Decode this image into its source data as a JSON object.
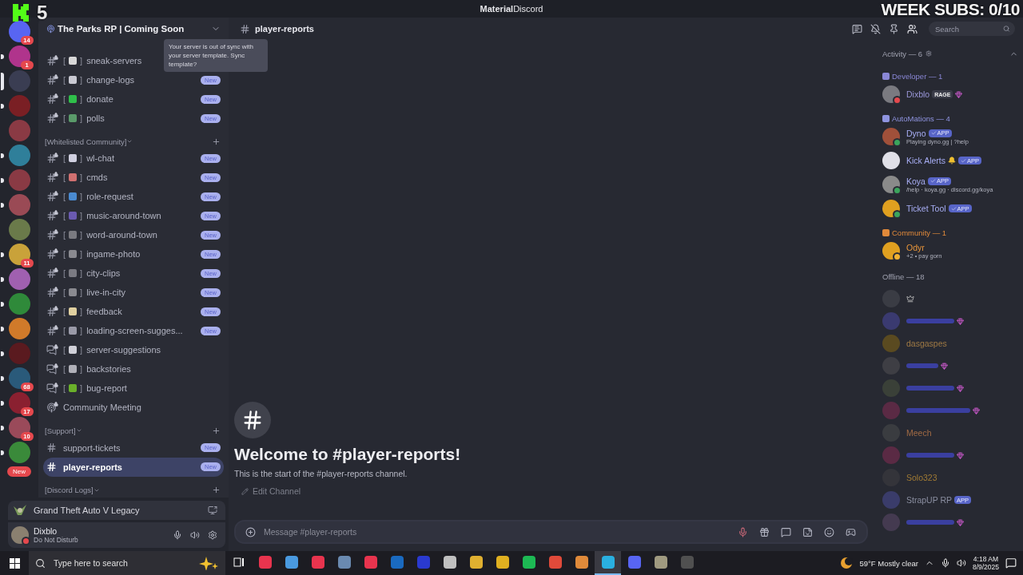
{
  "title_bar": {
    "title": "**Material**Discord",
    "overlay_count": "5",
    "subs": "WEEK SUBS: 0/10"
  },
  "servers": [
    {
      "mentions": "14",
      "unread": false,
      "selected": false,
      "color": "#5865f2"
    },
    {
      "mentions": "1",
      "unread": true,
      "selected": false,
      "color": "#b0348c"
    },
    {
      "unread": false,
      "selected": true,
      "color": "#3a3d52"
    },
    {
      "unread": true,
      "selected": false,
      "color": "#7a1f24"
    },
    {
      "unread": false,
      "selected": false,
      "color": "#8a3a44"
    },
    {
      "unread": true,
      "selected": false,
      "color": "#2f7f9a"
    },
    {
      "unread": true,
      "selected": false,
      "color": "#8a3a44"
    },
    {
      "unread": true,
      "selected": false,
      "color": "#9a4a55"
    },
    {
      "unread": false,
      "selected": false,
      "color": "#6a7a4a"
    },
    {
      "mentions": "11",
      "unread": true,
      "selected": false,
      "color": "#c9a23a"
    },
    {
      "unread": true,
      "selected": false,
      "color": "#a060b0"
    },
    {
      "unread": true,
      "selected": false,
      "color": "#2f8a3a"
    },
    {
      "unread": true,
      "selected": false,
      "color": "#d07a2a"
    },
    {
      "unread": true,
      "selected": false,
      "color": "#5a1a1f"
    },
    {
      "mentions": "68",
      "unread": true,
      "selected": false,
      "color": "#2a5a7a"
    },
    {
      "mentions": "17",
      "unread": true,
      "selected": false,
      "color": "#8a2030"
    },
    {
      "mentions": "10",
      "unread": true,
      "selected": false,
      "color": "#9a4a5a"
    },
    {
      "unread": true,
      "selected": false,
      "color": "#3a8a3a"
    }
  ],
  "new_pill": "New",
  "channel_pane": {
    "server_name": "The Parks RP | Coming Soon",
    "tooltip": "Your server is out of sync with your server template. Sync template?",
    "brackets": [
      "[",
      "]"
    ],
    "sections": [
      {
        "channels": [
          {
            "kind": "text",
            "name": "sneak-servers",
            "locked": true,
            "color": "#d8d8d8",
            "selected": false
          },
          {
            "kind": "text",
            "name": "change-logs",
            "locked": true,
            "color": "#c9c9d2",
            "badge": "New",
            "selected": false
          },
          {
            "kind": "text",
            "name": "donate",
            "locked": true,
            "color": "#2fbf4a",
            "badge": "New",
            "selected": false
          },
          {
            "kind": "text",
            "name": "polls",
            "locked": true,
            "color": "#5a9a6a",
            "badge": "New",
            "selected": false
          }
        ]
      },
      {
        "category": "[Whitelisted Community]",
        "channels": [
          {
            "kind": "text",
            "name": "wl-chat",
            "locked": true,
            "color": "#d0d0e0",
            "badge": "New",
            "selected": false
          },
          {
            "kind": "text",
            "name": "cmds",
            "locked": true,
            "color": "#d07070",
            "badge": "New",
            "selected": false
          },
          {
            "kind": "text",
            "name": "role-request",
            "locked": true,
            "color": "#4a8ad0",
            "badge": "New",
            "selected": false
          },
          {
            "kind": "text",
            "name": "music-around-town",
            "locked": true,
            "color": "#6a5ab0",
            "badge": "New",
            "selected": false
          },
          {
            "kind": "text",
            "name": "word-around-town",
            "locked": true,
            "color": "#7a7a80",
            "badge": "New",
            "selected": false
          },
          {
            "kind": "text",
            "name": "ingame-photo",
            "locked": true,
            "color": "#8a8a90",
            "badge": "New",
            "selected": false
          },
          {
            "kind": "text",
            "name": "city-clips",
            "locked": true,
            "color": "#7a7a82",
            "badge": "New",
            "selected": false
          },
          {
            "kind": "text",
            "name": "live-in-city",
            "locked": true,
            "color": "#8a8a90",
            "badge": "New",
            "selected": false
          },
          {
            "kind": "text",
            "name": "feedback",
            "locked": true,
            "color": "#e0d0a0",
            "badge": "New",
            "selected": false
          },
          {
            "kind": "text",
            "name": "loading-screen-sugges...",
            "locked": true,
            "color": "#9a9aa8",
            "badge": "New",
            "selected": false
          },
          {
            "kind": "forum",
            "name": "server-suggestions",
            "locked": true,
            "color": "#d0d0d8",
            "selected": false
          },
          {
            "kind": "forum",
            "name": "backstories",
            "locked": true,
            "color": "#b0b0b8",
            "selected": false
          },
          {
            "kind": "forum",
            "name": "bug-report",
            "locked": true,
            "color": "#6ab02a",
            "selected": false
          },
          {
            "kind": "stage",
            "name": "Community Meeting",
            "locked": true,
            "selected": false
          }
        ]
      },
      {
        "category": "[Support]",
        "channels": [
          {
            "kind": "text",
            "name": "support-tickets",
            "locked": false,
            "badge": "New",
            "selected": false
          },
          {
            "kind": "text",
            "name": "player-reports",
            "locked": false,
            "badge": "New",
            "selected": true
          }
        ]
      },
      {
        "category": "[Discord Logs]"
      }
    ]
  },
  "activity_panel": {
    "game": "Grand Theft Auto V Legacy"
  },
  "user_panel": {
    "name": "Dixblo",
    "status_text": "Do Not Disturb",
    "status": {
      "kind": "dnd"
    }
  },
  "main": {
    "channel": "player-reports",
    "search_placeholder": "Search",
    "welcome_title": "Welcome to #player-reports!",
    "welcome_text": "This is the start of the #player-reports channel.",
    "edit_label": "Edit Channel",
    "composer_placeholder": "Message #player-reports"
  },
  "members": {
    "activity_title": "Activity — 6",
    "groups": [
      {
        "title": "Developer — 1",
        "color": "#8a87d6",
        "members": [
          {
            "name": "Dixblo",
            "color": "#9a97d8",
            "status": {
              "kind": "dnd"
            },
            "tag": "RAGE",
            "extra": {
              "kind": "boost"
            }
          }
        ]
      },
      {
        "title": "AutoMations — 4",
        "color": "#8f94e0",
        "members": [
          {
            "name": "Dyno",
            "color": "#a8aef5",
            "status": {
              "kind": "online"
            },
            "badge": "APP",
            "subtitle": "Playing dyno.gg | ?help"
          },
          {
            "name": "Kick Alerts",
            "color": "#a8aef5",
            "extra": {
              "kind": "bell"
            },
            "badge": "APP"
          },
          {
            "name": "Koya",
            "color": "#a8aef5",
            "status": {
              "kind": "online"
            },
            "badge": "APP",
            "subtitle": "/help · koya.gg · discord.gg/koya"
          },
          {
            "name": "Ticket Tool",
            "color": "#a8aef5",
            "status": {
              "kind": "online"
            },
            "badge": "APP"
          }
        ]
      },
      {
        "title": "Community — 1",
        "color": "#e0893a",
        "members": [
          {
            "name": "Odyr",
            "color": "#e8953a",
            "status": {
              "kind": "idle"
            },
            "subtitle": "+2 • pay gorn"
          }
        ]
      }
    ],
    "offline_title": "Offline — 18",
    "offline": [
      {
        "extra": {
          "kind": "crown"
        }
      },
      {
        "color": "#3a3fa0",
        "extra": {
          "kind": "boost"
        }
      },
      {
        "name": "dasgaspes",
        "color": "#a07a44"
      },
      {
        "color": "#3a3fa0",
        "extra": {
          "kind": "boost"
        }
      },
      {
        "color": "#3a3fa0",
        "extra": {
          "kind": "boost"
        }
      },
      {
        "color": "#3a3fa0",
        "extra": {
          "kind": "boost"
        }
      },
      {
        "name": "Meech",
        "color": "#a06a44"
      },
      {
        "color": "#3a3fa0",
        "extra": {
          "kind": "boost"
        }
      },
      {
        "name": "Solo323",
        "color": "#a07a34"
      },
      {
        "name": "StrapUP RP",
        "color": "#8a8ea0",
        "badge": "APP"
      },
      {
        "color": "#3a3fa0",
        "extra": {
          "kind": "boost"
        }
      }
    ]
  },
  "taskbar": {
    "search_placeholder": "Type here to search",
    "apps": [
      {
        "color": "#e8344e",
        "active": false
      },
      {
        "color": "#4a9ae0",
        "active": false
      },
      {
        "color": "#e8344e",
        "active": false
      },
      {
        "color": "#6a8ab0",
        "active": false
      },
      {
        "color": "#e8344e",
        "active": false
      },
      {
        "color": "#1a6ac0",
        "active": false
      },
      {
        "color": "#2a3ad0",
        "active": false
      },
      {
        "color": "#c0c0c0",
        "active": false
      },
      {
        "color": "#e0b030",
        "active": false
      },
      {
        "color": "#e0b020",
        "active": false
      },
      {
        "color": "#1db954",
        "active": false
      },
      {
        "color": "#e04a3a",
        "active": false
      },
      {
        "color": "#e08a3a",
        "active": false
      },
      {
        "color": "#2ab0e0",
        "active": true
      },
      {
        "color": "#5865f2",
        "active": false
      },
      {
        "color": "#a09a80",
        "active": false
      },
      {
        "color": "#505050",
        "active": false
      }
    ],
    "weather": "59°F Mostly clear",
    "time": "4:18 AM",
    "date": "8/9/2025"
  }
}
